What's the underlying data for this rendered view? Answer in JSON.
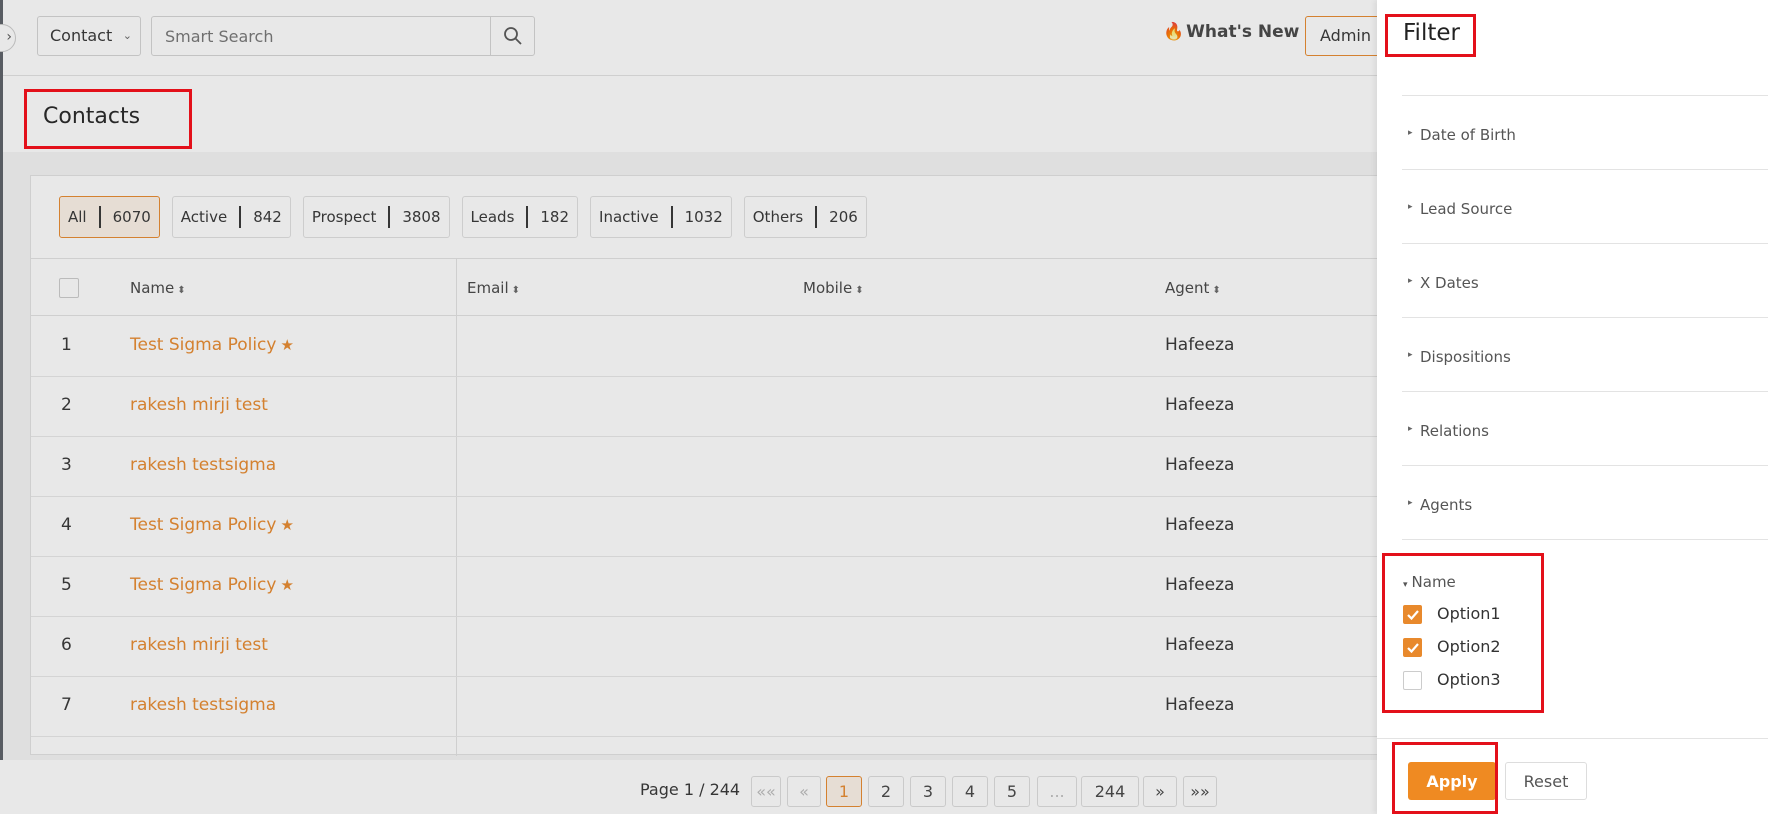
{
  "topbar": {
    "module": "Contact",
    "search_placeholder": "Smart Search",
    "whats_new": "What's New",
    "admin": "Admin"
  },
  "page": {
    "title": "Contacts"
  },
  "status_tabs": [
    {
      "label": "All",
      "count": "6070",
      "active": true
    },
    {
      "label": "Active",
      "count": "842"
    },
    {
      "label": "Prospect",
      "count": "3808"
    },
    {
      "label": "Leads",
      "count": "182"
    },
    {
      "label": "Inactive",
      "count": "1032"
    },
    {
      "label": "Others",
      "count": "206"
    }
  ],
  "table": {
    "headers": {
      "name": "Name",
      "email": "Email",
      "mobile": "Mobile",
      "agent": "Agent"
    },
    "rows": [
      {
        "num": "1",
        "name": "Test Sigma Policy",
        "starred": true,
        "agent": "Hafeeza"
      },
      {
        "num": "2",
        "name": "rakesh mirji test",
        "starred": false,
        "agent": "Hafeeza"
      },
      {
        "num": "3",
        "name": "rakesh testsigma",
        "starred": false,
        "agent": "Hafeeza"
      },
      {
        "num": "4",
        "name": "Test Sigma Policy",
        "starred": true,
        "agent": "Hafeeza"
      },
      {
        "num": "5",
        "name": "Test Sigma Policy",
        "starred": true,
        "agent": "Hafeeza"
      },
      {
        "num": "6",
        "name": "rakesh mirji test",
        "starred": false,
        "agent": "Hafeeza"
      },
      {
        "num": "7",
        "name": "rakesh testsigma",
        "starred": false,
        "agent": "Hafeeza"
      }
    ]
  },
  "pager": {
    "info": "Page 1 / 244",
    "first": "««",
    "prev": "«",
    "pages": [
      "1",
      "2",
      "3",
      "4",
      "5"
    ],
    "current": "1",
    "ellipsis": "...",
    "last_page": "244",
    "next": "»",
    "last": "»»"
  },
  "filter": {
    "title": "Filter",
    "sections": [
      "Date of Birth",
      "Lead Source",
      "X Dates",
      "Dispositions",
      "Relations",
      "Agents"
    ],
    "name_group": {
      "title": "Name",
      "options": [
        {
          "label": "Option1",
          "checked": true
        },
        {
          "label": "Option2",
          "checked": true
        },
        {
          "label": "Option3",
          "checked": false
        }
      ]
    },
    "apply": "Apply",
    "reset": "Reset"
  },
  "colors": {
    "accent": "#e8892c",
    "highlight": "#e3101a"
  }
}
